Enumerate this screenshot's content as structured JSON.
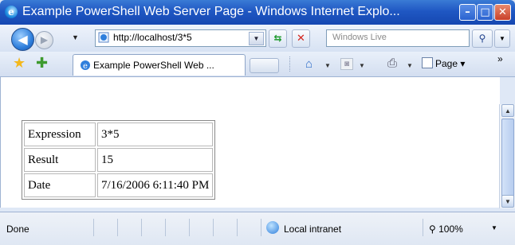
{
  "window": {
    "title": "Example PowerShell Web Server Page - Windows Internet Explo...",
    "minimize": "–",
    "maximize": "□",
    "close": "✕"
  },
  "nav": {
    "back": "◀",
    "forward": "▶",
    "address": "http://localhost/3*5",
    "search_placeholder": "Windows Live"
  },
  "tabs": {
    "active_label": "Example PowerShell Web ...",
    "page_menu": "Page"
  },
  "table": {
    "rows": [
      {
        "key": "Expression",
        "value": "3*5"
      },
      {
        "key": "Result",
        "value": "15"
      },
      {
        "key": "Date",
        "value": "7/16/2006 6:11:40 PM"
      }
    ]
  },
  "status": {
    "text": "Done",
    "zone": "Local intranet",
    "zoom": "100%"
  },
  "icons": {
    "back": "back-arrow-icon",
    "forward": "forward-arrow-icon",
    "refresh": "refresh-icon",
    "stop": "stop-icon",
    "search": "search-icon",
    "favorites": "star-icon",
    "add_favorites": "add-favorites-icon",
    "home": "home-icon",
    "feeds": "feeds-icon",
    "print": "printer-icon",
    "page": "page-icon",
    "zone": "intranet-globe-icon",
    "zoom": "zoom-icon"
  }
}
